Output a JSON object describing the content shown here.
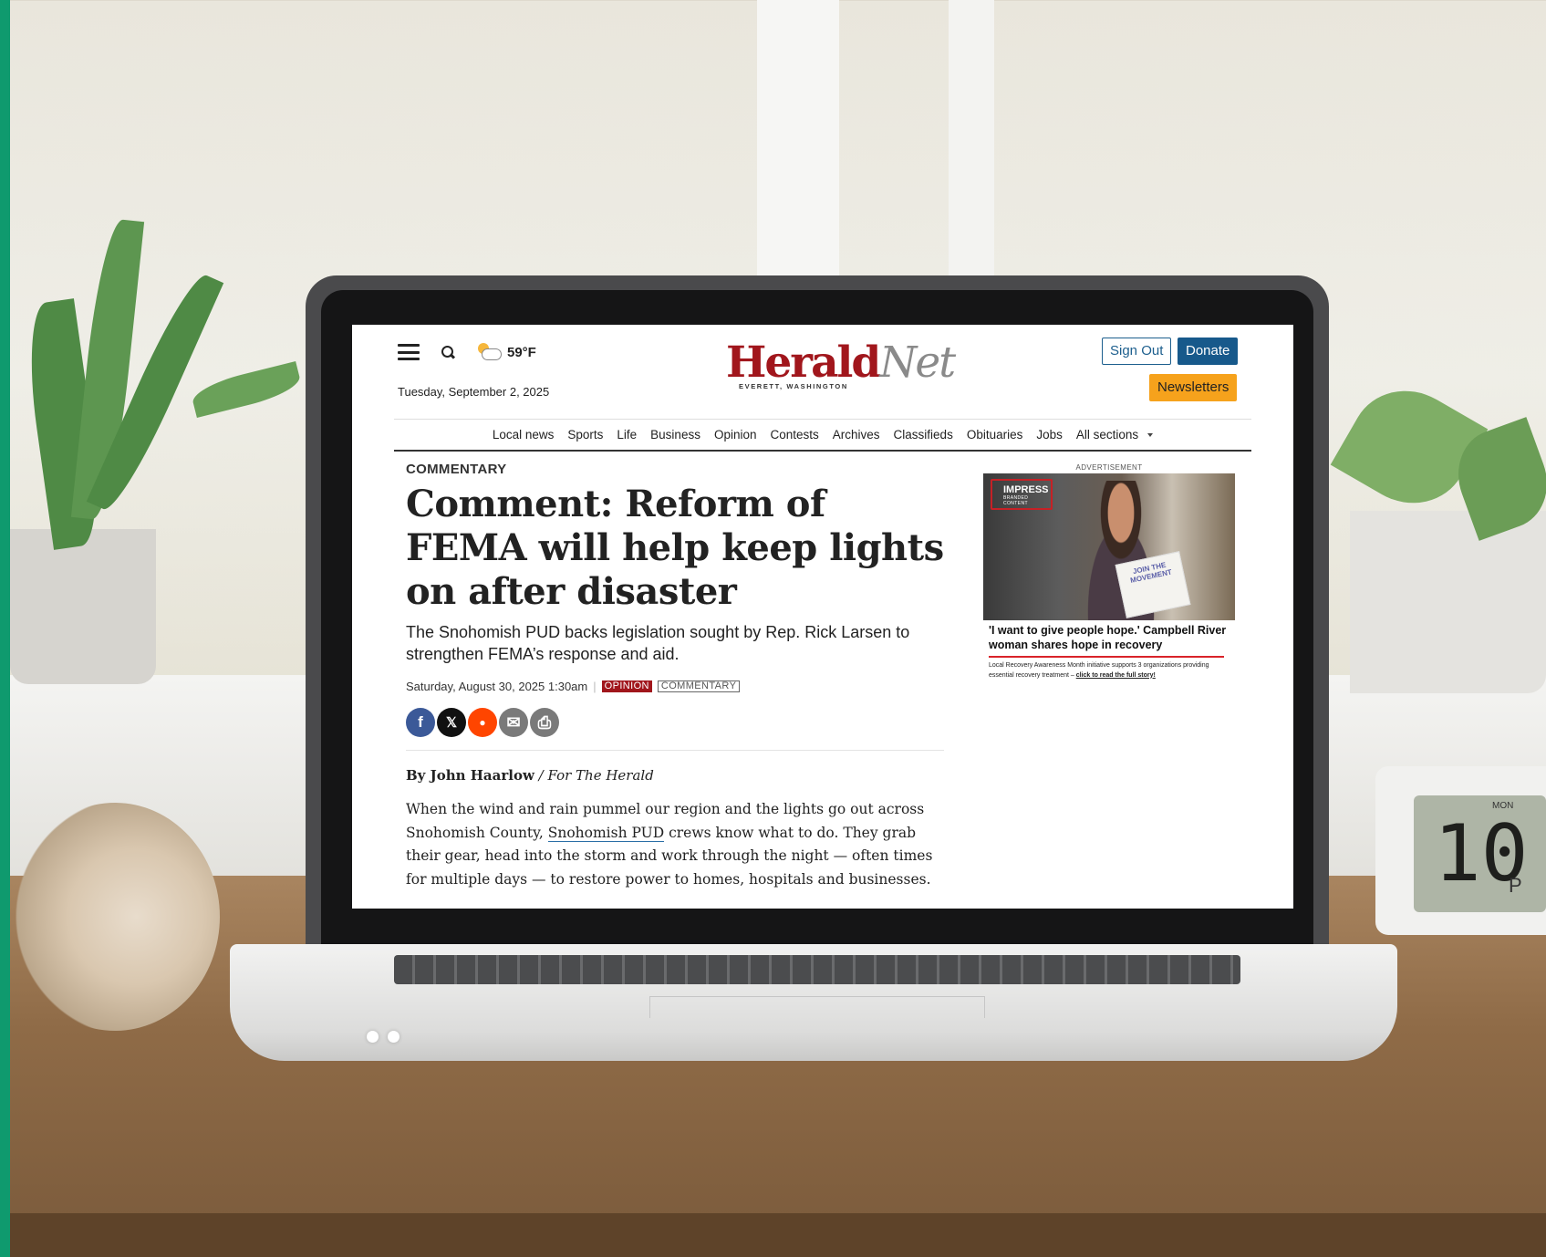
{
  "site": {
    "logo_main": "Herald",
    "logo_accent": "Net",
    "logo_location": "EVERETT, WASHINGTON",
    "date": "Tuesday, September 2, 2025",
    "weather": "59°F",
    "sign_out_label": "Sign Out",
    "donate_label": "Donate",
    "newsletters_label": "Newsletters"
  },
  "nav": {
    "items": [
      "Local news",
      "Sports",
      "Life",
      "Business",
      "Opinion",
      "Contests",
      "Archives",
      "Classifieds",
      "Obituaries",
      "Jobs",
      "All sections"
    ]
  },
  "article": {
    "kicker": "COMMENTARY",
    "headline": "Comment: Reform of FEMA will help keep lights on after disaster",
    "dek": "The Snohomish PUD backs legislation sought by Rep. Rick Larsen to strengthen FEMA’s response and aid.",
    "timestamp": "Saturday, August 30, 2025 1:30am",
    "tags": [
      "OPINION",
      "COMMENTARY"
    ],
    "share": [
      {
        "name": "facebook",
        "glyph": "f",
        "color": "#3b5998"
      },
      {
        "name": "x",
        "glyph": "𝕏",
        "color": "#111111"
      },
      {
        "name": "reddit",
        "glyph": "●",
        "color": "#ff4500"
      },
      {
        "name": "email",
        "glyph": "✉",
        "color": "#7a7a7a"
      },
      {
        "name": "print",
        "glyph": "⎙",
        "color": "#7a7a7a"
      }
    ],
    "byline_name": "By John Haarlow",
    "byline_sep": " / ",
    "byline_affil": "For The Herald",
    "body_before_link": "When the wind and rain pummel our region and the lights go out across Snohomish County, ",
    "body_link": "Snohomish PUD",
    "body_after_link": " crews know what to do. They grab their gear, head into the storm and work through the night — often times for multiple days — to restore power to homes, hospitals and businesses."
  },
  "ad": {
    "label": "ADVERTISEMENT",
    "brand": "IMPRESS",
    "brand_sub": "BRANDED CONTENT",
    "flyer_text": "JOIN THE MOVEMENT",
    "title": "'I want to give people hope.' Campbell River woman shares hope in recovery",
    "text": "Local Recovery Awareness Month initiative supports 3 organizations providing essential recovery treatment – ",
    "cta": "click to read the full story!"
  },
  "clock": {
    "digits": "10:",
    "day": "MON",
    "ampm": "P"
  }
}
